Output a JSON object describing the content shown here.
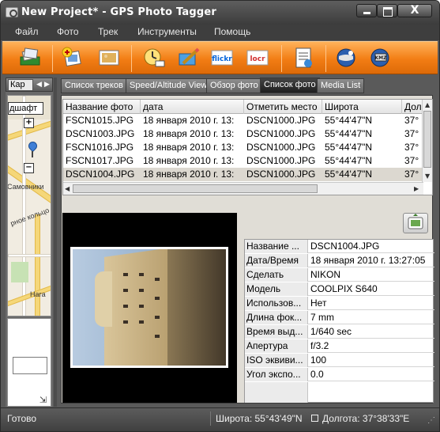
{
  "window": {
    "title": "New Project* - GPS Photo Tagger",
    "close_glyph": "X"
  },
  "menu": [
    "Файл",
    "Фото",
    "Трек",
    "Инструменты",
    "Помощь"
  ],
  "toolbar": {
    "icons": [
      "import-photos-icon",
      "add-photos-icon",
      "photo-album-icon",
      "time-sync-icon",
      "edit-icon",
      "flickr-icon",
      "locr-icon",
      "document-icon",
      "globe-export-icon",
      "kmz-export-icon"
    ],
    "flickr_label": "flickr",
    "locr_label": "locr",
    "kmz_label": "KMZ"
  },
  "sidebar": {
    "tab_label": "Кар",
    "map_search_value": "дшафт",
    "map_labels": [
      "Самовники",
      "рное кольцо",
      "Нага"
    ]
  },
  "tabs": [
    "Список треков",
    "Speed/Altitude View",
    "Обзор фото",
    "Список фото",
    "Media List"
  ],
  "active_tab": "Список фото",
  "photo_table": {
    "columns": [
      "Название фото",
      "дата",
      "Отметить место",
      "Широта",
      "Дол"
    ],
    "rows": [
      [
        "FSCN1015.JPG",
        "18 января 2010 г. 13:",
        "DSCN1000.JPG",
        "55°44'47\"N",
        "37°"
      ],
      [
        "DSCN1003.JPG",
        "18 января 2010 г. 13:",
        "DSCN1000.JPG",
        "55°44'47\"N",
        "37°"
      ],
      [
        "FSCN1016.JPG",
        "18 января 2010 г. 13:",
        "DSCN1000.JPG",
        "55°44'47\"N",
        "37°"
      ],
      [
        "FSCN1017.JPG",
        "18 января 2010 г. 13:",
        "DSCN1000.JPG",
        "55°44'47\"N",
        "37°"
      ],
      [
        "DSCN1004.JPG",
        "18 января 2010 г. 13:",
        "DSCN1000.JPG",
        "55°44'47\"N",
        "37°"
      ]
    ],
    "selected_row": 4
  },
  "properties": [
    [
      "Название ...",
      "DSCN1004.JPG"
    ],
    [
      "Дата/Время",
      "18 января 2010 г. 13:27:05"
    ],
    [
      "Сделать",
      "NIKON"
    ],
    [
      "Модель",
      "COOLPIX S640"
    ],
    [
      "Использов...",
      "Нет"
    ],
    [
      "Длина фок...",
      "7 mm"
    ],
    [
      "Время выд...",
      "1/640 sec"
    ],
    [
      "Апертура",
      "f/3.2"
    ],
    [
      "ISO эквиви...",
      "100"
    ],
    [
      "Угол экспо...",
      "0.0"
    ]
  ],
  "status": {
    "ready": "Готово",
    "latitude": "Широта: 55°43'49\"N",
    "longitude": "Долгота: 37°38'33\"E"
  },
  "colors": {
    "toolbar_accent": "#f27d14",
    "window_chrome": "#5a5a5a",
    "selected_row": "#dcd8d0"
  }
}
